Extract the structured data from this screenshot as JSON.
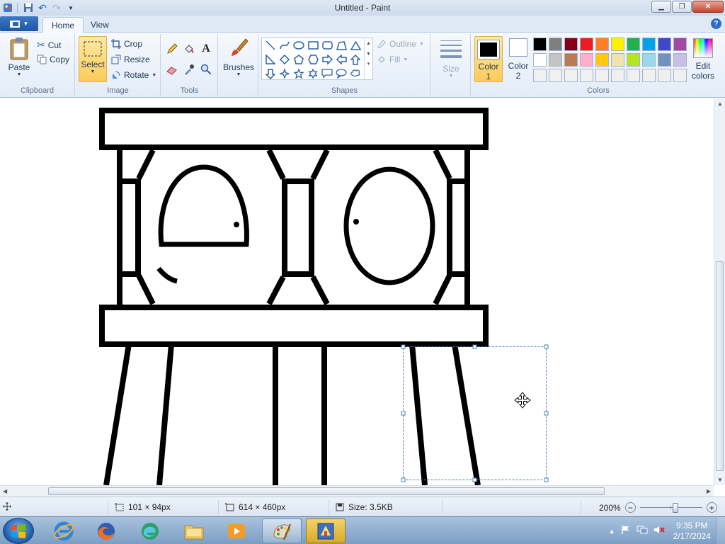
{
  "window": {
    "title": "Untitled - Paint"
  },
  "quick_access": {
    "save_icon": "save-icon",
    "undo_icon": "undo-icon",
    "redo_icon": "redo-icon",
    "customize_icon": "chevron-down-icon"
  },
  "tabs": [
    {
      "label": "Home",
      "active": true
    },
    {
      "label": "View",
      "active": false
    }
  ],
  "ribbon": {
    "clipboard": {
      "paste": "Paste",
      "cut": "Cut",
      "copy": "Copy",
      "group": "Clipboard"
    },
    "image": {
      "select": "Select",
      "crop": "Crop",
      "resize": "Resize",
      "rotate": "Rotate",
      "group": "Image"
    },
    "tools": {
      "group": "Tools"
    },
    "brushes": {
      "label": "Brushes"
    },
    "shapes": {
      "outline": "Outline",
      "fill": "Fill",
      "group": "Shapes"
    },
    "size": {
      "label": "Size"
    },
    "colors": {
      "color1_label": "Color",
      "color1_num": "1",
      "color2_label": "Color",
      "color2_num": "2",
      "edit_label": "Edit",
      "edit_label2": "colors",
      "group": "Colors",
      "color1": "#000000",
      "color2": "#ffffff",
      "palette": [
        "#000000",
        "#7f7f7f",
        "#880015",
        "#ed1c24",
        "#ff7f27",
        "#fff200",
        "#22b14c",
        "#00a2e8",
        "#3f48cc",
        "#a349a4",
        "#ffffff",
        "#c3c3c3",
        "#b97a57",
        "#ffaec9",
        "#ffc90e",
        "#efe4b0",
        "#b5e61d",
        "#99d9ea",
        "#7092be",
        "#c8bfe7",
        "#f0f0f0",
        "#f0f0f0",
        "#f0f0f0",
        "#f0f0f0",
        "#f0f0f0",
        "#f0f0f0",
        "#f0f0f0",
        "#f0f0f0",
        "#f0f0f0",
        "#f0f0f0"
      ]
    }
  },
  "status": {
    "selection_size": "101 × 94px",
    "image_size": "614 × 460px",
    "file_size": "Size: 3.5KB",
    "zoom": "200%"
  },
  "taskbar": {
    "apps": [
      "internet-explorer-icon",
      "firefox-icon",
      "edge-icon",
      "file-explorer-icon",
      "media-player-icon",
      "paint-icon",
      "app-icon"
    ],
    "time": "9:35 PM",
    "date": "2/17/2024"
  }
}
